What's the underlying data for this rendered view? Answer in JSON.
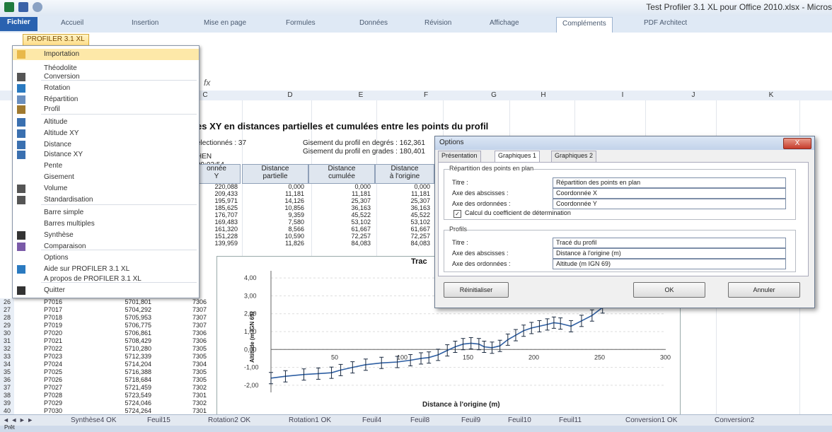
{
  "window": {
    "title": "Test Profiler 3.1 XL pour Office 2010.xlsx - Micros"
  },
  "ribbon": {
    "tabs": [
      "Fichier",
      "Accueil",
      "Insertion",
      "Mise en page",
      "Formules",
      "Données",
      "Révision",
      "Affichage",
      "Compléments",
      "PDF Architect"
    ],
    "active_tab": "Compléments",
    "addin_button": "PROFILER 3.1 XL"
  },
  "formula_bar": {
    "fx": "fx"
  },
  "columns": [
    "C",
    "D",
    "E",
    "F",
    "G",
    "H",
    "I",
    "J",
    "K"
  ],
  "menu": {
    "items": [
      {
        "label": "Importation",
        "icon": "folder-icon"
      },
      {
        "label": "Théodolite",
        "icon": ""
      },
      {
        "label": "Conversion",
        "icon": "conversion-icon"
      },
      {
        "label": "Rotation",
        "icon": "rotation-icon"
      },
      {
        "label": "Répartition",
        "icon": "scatter-icon"
      },
      {
        "label": "Profil",
        "icon": "profile-icon"
      },
      {
        "label": "Altitude",
        "icon": "altitude-icon"
      },
      {
        "label": "Altitude XY",
        "icon": "altitude-xy-icon"
      },
      {
        "label": "Distance",
        "icon": "distance-icon"
      },
      {
        "label": "Distance XY",
        "icon": "distance-xy-icon"
      },
      {
        "label": "Pente",
        "icon": ""
      },
      {
        "label": "Gisement",
        "icon": ""
      },
      {
        "label": "Volume",
        "icon": "volume-icon"
      },
      {
        "label": "Standardisation",
        "icon": "standardisation-icon"
      },
      {
        "label": "Barre simple",
        "icon": ""
      },
      {
        "label": "Barres multiples",
        "icon": ""
      },
      {
        "label": "Synthèse",
        "icon": "sigma-icon"
      },
      {
        "label": "Comparaison",
        "icon": "comparison-icon"
      },
      {
        "label": "Options",
        "icon": ""
      },
      {
        "label": "Aide sur PROFILER 3.1 XL",
        "icon": "help-icon"
      },
      {
        "label": "A propos de PROFILER 3.1 XL",
        "icon": ""
      },
      {
        "label": "Quitter",
        "icon": "close-icon"
      }
    ]
  },
  "sheet": {
    "title": "es XY en distances partielles et cumulées entre les points du profil",
    "info_left": [
      "électionnés : 37",
      "HEN",
      "09:02:54"
    ],
    "info_right": [
      "Gisement du profil en degrés : 162,361",
      "Gisement du profil en grades : 180,401"
    ],
    "headers": [
      {
        "line1": "onnée",
        "line2": "Y"
      },
      {
        "line1": "Distance",
        "line2": "partielle"
      },
      {
        "line1": "Distance",
        "line2": "cumulée"
      },
      {
        "line1": "Distance",
        "line2": "à l'origine"
      }
    ],
    "table_rows": [
      [
        "220,088",
        "0,000",
        "0,000",
        "0,000"
      ],
      [
        "209,433",
        "11,181",
        "11,181",
        "11,181"
      ],
      [
        "195,971",
        "14,126",
        "25,307",
        "25,307"
      ],
      [
        "185,625",
        "10,856",
        "36,163",
        "36,163"
      ],
      [
        "176,707",
        "9,359",
        "45,522",
        "45,522"
      ],
      [
        "169,483",
        "7,580",
        "53,102",
        "53,102"
      ],
      [
        "161,320",
        "8,566",
        "61,667",
        "61,667"
      ],
      [
        "151,228",
        "10,590",
        "72,257",
        "72,257"
      ],
      [
        "139,959",
        "11,826",
        "84,083",
        "84,083"
      ]
    ],
    "lower_rows": [
      {
        "row": "26",
        "pt": "P7016",
        "x": "5701,801",
        "y": "7306"
      },
      {
        "row": "27",
        "pt": "P7017",
        "x": "5704,292",
        "y": "7307"
      },
      {
        "row": "28",
        "pt": "P7018",
        "x": "5705,953",
        "y": "7307"
      },
      {
        "row": "29",
        "pt": "P7019",
        "x": "5706,775",
        "y": "7307"
      },
      {
        "row": "30",
        "pt": "P7020",
        "x": "5706,861",
        "y": "7306"
      },
      {
        "row": "31",
        "pt": "P7021",
        "x": "5708,429",
        "y": "7306"
      },
      {
        "row": "32",
        "pt": "P7022",
        "x": "5710,280",
        "y": "7305"
      },
      {
        "row": "33",
        "pt": "P7023",
        "x": "5712,339",
        "y": "7305"
      },
      {
        "row": "34",
        "pt": "P7024",
        "x": "5714,204",
        "y": "7304"
      },
      {
        "row": "35",
        "pt": "P7025",
        "x": "5716,388",
        "y": "7305"
      },
      {
        "row": "36",
        "pt": "P7026",
        "x": "5718,684",
        "y": "7305"
      },
      {
        "row": "37",
        "pt": "P7027",
        "x": "5721,459",
        "y": "7302"
      },
      {
        "row": "38",
        "pt": "P7028",
        "x": "5723,549",
        "y": "7301"
      },
      {
        "row": "39",
        "pt": "P7029",
        "x": "5724,046",
        "y": "7302"
      },
      {
        "row": "40",
        "pt": "P7030",
        "x": "5724,264",
        "y": "7301"
      }
    ]
  },
  "chart": {
    "title": "Trac",
    "xlabel": "Distance à l'origine (m)",
    "ylabel": "Altitude (m IGN 69)",
    "y_ticks": [
      "4,00",
      "3,00",
      "2,00",
      "1,00",
      "0,00",
      "-1,00",
      "-2,00"
    ],
    "x_ticks": [
      "50",
      "100",
      "150",
      "200",
      "250",
      "300"
    ]
  },
  "chart_data": {
    "type": "line",
    "title": "",
    "xlabel": "Distance à l'origine (m)",
    "ylabel": "Altitude (m IGN 69)",
    "xlim": [
      0,
      300
    ],
    "ylim": [
      -2.4,
      4.4
    ],
    "x": [
      0,
      11,
      25,
      36,
      46,
      53,
      62,
      72,
      84,
      96,
      106,
      114,
      120,
      127,
      134,
      140,
      146,
      152,
      158,
      162,
      168,
      174,
      180,
      186,
      192,
      198,
      204,
      210,
      215,
      220,
      228,
      236,
      244,
      252
    ],
    "y": [
      -1.6,
      -1.5,
      -1.4,
      -1.35,
      -1.3,
      -1.15,
      -1.0,
      -0.85,
      -0.75,
      -0.7,
      -0.6,
      -0.5,
      -0.45,
      -0.3,
      -0.05,
      0.15,
      0.3,
      0.35,
      0.3,
      0.15,
      0.1,
      0.2,
      0.55,
      0.8,
      1.05,
      1.2,
      1.3,
      1.4,
      1.5,
      1.45,
      1.3,
      1.6,
      1.9,
      2.35
    ]
  },
  "dialog": {
    "title": "Options",
    "close": "X",
    "tabs": [
      "Présentation",
      "Graphiques 1",
      "Graphiques 2"
    ],
    "active_tab": "Graphiques 1",
    "group1": {
      "label": "Répartition des points en plan",
      "fields": [
        {
          "label": "Titre :",
          "value": "Répartition des points en plan"
        },
        {
          "label": "Axe des abscisses :",
          "value": "Coordonnée X"
        },
        {
          "label": "Axe des ordonnées :",
          "value": "Coordonnée Y"
        }
      ],
      "checkbox": "Calcul du coefficient de détermination",
      "checkbox_checked": true
    },
    "group2": {
      "label": "Profils",
      "fields": [
        {
          "label": "Titre :",
          "value": "Tracé du profil"
        },
        {
          "label": "Axe des abscisses :",
          "value": "Distance à l'origine (m)"
        },
        {
          "label": "Axe des ordonnées :",
          "value": "Altitude (m IGN 69)"
        }
      ]
    },
    "buttons": {
      "reset": "Réinitialiser",
      "ok": "OK",
      "cancel": "Annuler"
    }
  },
  "sheet_tabs": [
    "Synthèse4 OK",
    "Feuil15",
    "Rotation2 OK",
    "Rotation1 OK",
    "Feuil4",
    "Feuil8",
    "Feuil9",
    "Feuil10",
    "Feuil11",
    "Conversion1 OK",
    "Conversion2"
  ],
  "status": {
    "mode": "Prêt"
  }
}
